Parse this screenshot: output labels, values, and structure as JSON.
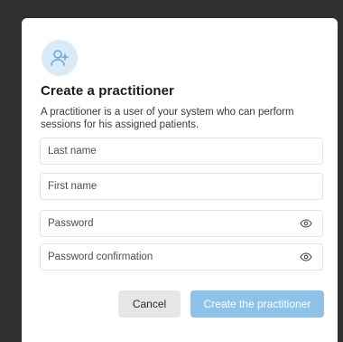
{
  "dialog": {
    "title": "Create a practitioner",
    "description": "A practitioner is a user of your system who can perform sessions for his assigned patients.",
    "icon": "add-user-icon",
    "icon_bg": "#dbeaf7",
    "icon_color": "#6aa3d6"
  },
  "form": {
    "last_name": {
      "placeholder": "Last name",
      "value": ""
    },
    "first_name": {
      "placeholder": "First name",
      "value": ""
    },
    "password": {
      "placeholder": "Password",
      "value": "",
      "icon": "eye-icon"
    },
    "password_confirmation": {
      "placeholder": "Password confirmation",
      "value": "",
      "icon": "eye-icon"
    }
  },
  "actions": {
    "cancel_label": "Cancel",
    "create_label": "Create the practitioner",
    "create_color": "#8ec3e9"
  }
}
